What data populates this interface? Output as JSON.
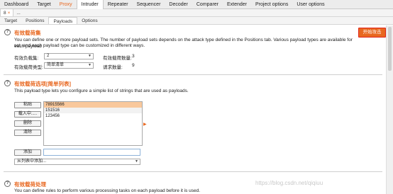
{
  "menubar": {
    "items": [
      "Dashboard",
      "Target",
      "Proxy",
      "Intruder",
      "Repeater",
      "Sequencer",
      "Decoder",
      "Comparer",
      "Extender",
      "Project options",
      "User options"
    ]
  },
  "attack_tabs": {
    "tab1": "8",
    "tab1_close": "×",
    "more": "..."
  },
  "subtabs": {
    "items": [
      "Target",
      "Positions",
      "Payloads",
      "Options"
    ]
  },
  "payload_sets": {
    "title": "有效载荷集",
    "desc_line1": "You can define one or more payload sets. The number of payload sets depends on the attack type defined in the Positions tab. Various payload types are available for each payload",
    "desc_line2": "set, and each payload type can be customized in different ways.",
    "set_label": "有效负载集:",
    "set_value": "2",
    "count_label": "有效载荷数量:",
    "count_value": "3",
    "type_label": "有效载荷类型:",
    "type_value": "简单清单",
    "request_label": "请求数量:",
    "request_value": "9",
    "start_button": "开始攻击"
  },
  "payload_options": {
    "title": "有效载荷选项[简单列表]",
    "desc": "This payload type lets you configure a simple list of strings that are used as payloads.",
    "buttons": {
      "paste": "粘贴",
      "load": "载入中.....",
      "remove": "删除",
      "clear": "清除",
      "add": "添加"
    },
    "items": [
      "78915566",
      "151516",
      "123456"
    ],
    "from_list": "从列表中添加..."
  },
  "processing": {
    "title": "有效载荷处理",
    "desc": "You can define rules to perform various processing tasks on each payload before it is used."
  },
  "watermark": "https://blog.csdn.net/qiqiuu",
  "help_glyph": "?",
  "arrow_glyph": "▼",
  "list_arrow_glyph": "▶",
  "colors": {
    "accent": "#e8671f",
    "highlight": "#f9c89c",
    "border_red": "#e0241b"
  }
}
